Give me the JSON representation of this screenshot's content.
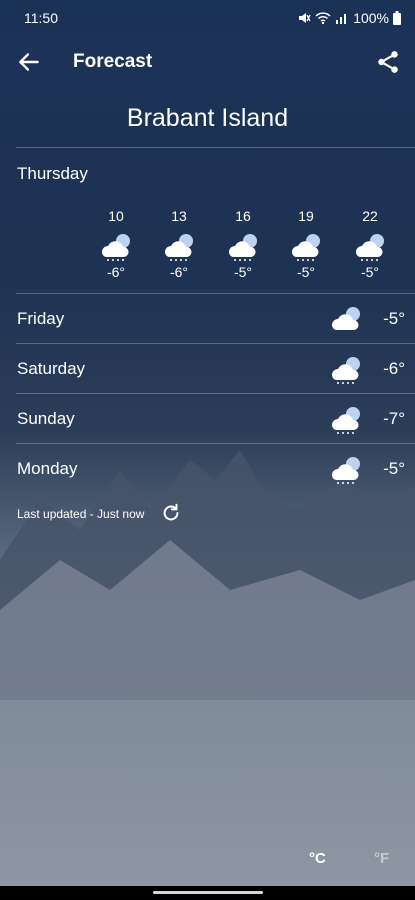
{
  "status_bar": {
    "time": "11:50",
    "battery": "100%"
  },
  "app_bar": {
    "title": "Forecast"
  },
  "location": "Brabant Island",
  "today": {
    "label": "Thursday",
    "hours": [
      {
        "hour": "10",
        "temp": "-6°",
        "icon": "cloud-snow-icon"
      },
      {
        "hour": "13",
        "temp": "-6°",
        "icon": "cloud-snow-icon"
      },
      {
        "hour": "16",
        "temp": "-5°",
        "icon": "cloud-snow-icon"
      },
      {
        "hour": "19",
        "temp": "-5°",
        "icon": "cloud-snow-icon"
      },
      {
        "hour": "22",
        "temp": "-5°",
        "icon": "cloud-snow-icon"
      }
    ]
  },
  "days": [
    {
      "name": "Friday",
      "temp": "-5°",
      "icon": "cloud-icon"
    },
    {
      "name": "Saturday",
      "temp": "-6°",
      "icon": "cloud-snow-icon"
    },
    {
      "name": "Sunday",
      "temp": "-7°",
      "icon": "cloud-snow-icon"
    },
    {
      "name": "Monday",
      "temp": "-5°",
      "icon": "cloud-snow-icon"
    }
  ],
  "last_updated": "Last updated - Just now",
  "units": {
    "celsius": "°C",
    "fahrenheit": "°F",
    "selected": "celsius"
  }
}
